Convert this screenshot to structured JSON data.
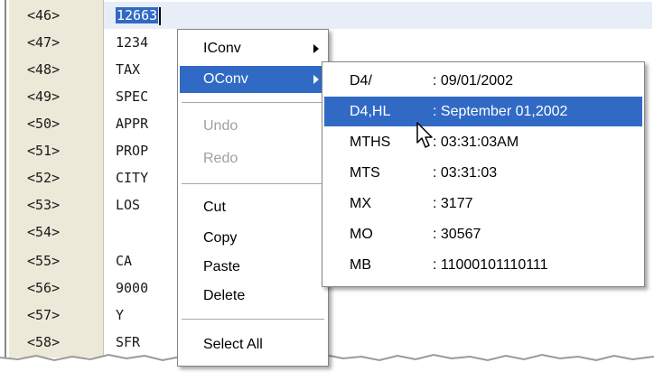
{
  "editor": {
    "lines": [
      {
        "num": "<46>",
        "text": "12663",
        "selected": true
      },
      {
        "num": "<47>",
        "text": "1234"
      },
      {
        "num": "<48>",
        "text": "TAX"
      },
      {
        "num": "<49>",
        "text": "SPEC"
      },
      {
        "num": "<50>",
        "text": "APPR"
      },
      {
        "num": "<51>",
        "text": "PROP"
      },
      {
        "num": "<52>",
        "text": "CITY"
      },
      {
        "num": "<53>",
        "text": "LOS"
      },
      {
        "num": "<54>",
        "text": ""
      },
      {
        "num": "<55>",
        "text": "CA"
      },
      {
        "num": "<56>",
        "text": "9000"
      },
      {
        "num": "<57>",
        "text": "Y"
      },
      {
        "num": "<58>",
        "text": "SFR"
      }
    ]
  },
  "context_menu": {
    "iconv": "IConv",
    "oconv": "OConv",
    "undo": "Undo",
    "redo": "Redo",
    "cut": "Cut",
    "copy": "Copy",
    "paste": "Paste",
    "delete": "Delete",
    "select_all": "Select All"
  },
  "oconv_menu": {
    "items": [
      {
        "code": "D4/",
        "value": ": 09/01/2002"
      },
      {
        "code": "D4,HL",
        "value": ": September 01,2002",
        "highlighted": true
      },
      {
        "code": "MTHS",
        "value": ": 03:31:03AM"
      },
      {
        "code": "MTS",
        "value": ": 03:31:03"
      },
      {
        "code": "MX",
        "value": ": 3177"
      },
      {
        "code": "MO",
        "value": ": 30567"
      },
      {
        "code": "MB",
        "value": ": 11000101110111"
      }
    ]
  },
  "colors": {
    "selection": "#316AC5",
    "gutter": "#ECE9D8"
  },
  "icons": {
    "pointer": "mouse-pointer-icon",
    "submenu": "submenu-arrow-icon"
  }
}
